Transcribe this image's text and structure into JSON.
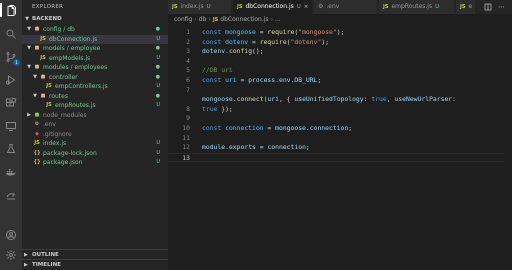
{
  "activity": {
    "items": [
      "files-icon",
      "search-icon",
      "source-control-icon",
      "run-debug-icon",
      "extensions-icon",
      "remote-icon",
      "test-icon",
      "docker-icon",
      "live-share-icon"
    ],
    "source_control_badge": "1",
    "bottom": [
      "account-icon",
      "settings-gear-icon"
    ]
  },
  "sidebar": {
    "title": "EXPLORER",
    "root": "BACKEND",
    "tree": [
      {
        "label": "config / db",
        "kind": "folder",
        "open": true,
        "depth": 1,
        "status": "●",
        "color": "green"
      },
      {
        "label": "dbConnection.js",
        "kind": "js",
        "depth": 2,
        "status": "U",
        "color": "green",
        "selected": true
      },
      {
        "label": "models / employee",
        "kind": "folder",
        "open": true,
        "depth": 1,
        "status": "●",
        "color": "green"
      },
      {
        "label": "empModels.js",
        "kind": "js",
        "depth": 2,
        "status": "U",
        "color": "green"
      },
      {
        "label": "modules / employees",
        "kind": "folder",
        "open": true,
        "depth": 1,
        "status": "●",
        "color": "green"
      },
      {
        "label": "controller",
        "kind": "folder",
        "open": true,
        "depth": 2,
        "status": "●",
        "color": "green"
      },
      {
        "label": "empControllers.js",
        "kind": "js",
        "depth": 3,
        "status": "U",
        "color": "green"
      },
      {
        "label": "routes",
        "kind": "folder",
        "open": true,
        "depth": 2,
        "status": "●",
        "color": "green"
      },
      {
        "label": "empRoutes.js",
        "kind": "js",
        "depth": 3,
        "status": "U",
        "color": "green"
      },
      {
        "label": "node_modules",
        "kind": "node",
        "open": false,
        "depth": 1,
        "status": "",
        "color": "gray"
      },
      {
        "label": ".env",
        "kind": "env",
        "depth": 1,
        "status": "",
        "color": "gray"
      },
      {
        "label": ".gitignore",
        "kind": "git",
        "depth": 1,
        "status": "",
        "color": "gray"
      },
      {
        "label": "index.js",
        "kind": "js",
        "depth": 1,
        "status": "U",
        "color": "green"
      },
      {
        "label": "package-lock.json",
        "kind": "json",
        "depth": 1,
        "status": "U",
        "color": "green"
      },
      {
        "label": "package.json",
        "kind": "json",
        "depth": 1,
        "status": "U",
        "color": "green"
      }
    ],
    "outline": "OUTLINE",
    "timeline": "TIMELINE"
  },
  "tabs": [
    {
      "icon": "JS",
      "label": "index.js",
      "status": "U",
      "active": false
    },
    {
      "icon": "JS",
      "label": "dbConnection.js",
      "status": "U",
      "active": true,
      "close": "×"
    },
    {
      "icon": "gear",
      "label": ".env",
      "status": "",
      "active": false
    },
    {
      "icon": "JS",
      "label": "empRoutes.js",
      "status": "U",
      "active": false
    },
    {
      "icon": "JS",
      "label": "e",
      "status": "",
      "active": false
    }
  ],
  "breadcrumb": {
    "parts": [
      "config",
      "db"
    ],
    "file": "dbConnection.js",
    "more": "..."
  },
  "editor": {
    "current_line": 13,
    "lines": [
      [
        [
          "kw",
          "const "
        ],
        [
          "var",
          "mongoose"
        ],
        [
          "punc",
          " = "
        ],
        [
          "fn",
          "require"
        ],
        [
          "punc",
          "("
        ],
        [
          "str",
          "\"mongoose\""
        ],
        [
          "punc",
          ");"
        ]
      ],
      [
        [
          "kw",
          "const "
        ],
        [
          "var",
          "dotenv"
        ],
        [
          "punc",
          " = "
        ],
        [
          "fn",
          "require"
        ],
        [
          "punc",
          "("
        ],
        [
          "str",
          "\"dotenv\""
        ],
        [
          "punc",
          ");"
        ]
      ],
      [
        [
          "prop",
          "dotenv"
        ],
        [
          "punc",
          "."
        ],
        [
          "fn",
          "config"
        ],
        [
          "punc",
          "();"
        ]
      ],
      [],
      [
        [
          "cmt",
          "//DB uri"
        ]
      ],
      [
        [
          "kw",
          "const "
        ],
        [
          "var",
          "uri"
        ],
        [
          "punc",
          " = "
        ],
        [
          "prop",
          "process"
        ],
        [
          "punc",
          "."
        ],
        [
          "prop",
          "env"
        ],
        [
          "punc",
          "."
        ],
        [
          "prop",
          "DB_URL"
        ],
        [
          "punc",
          ";"
        ]
      ],
      [],
      [
        [
          "prop",
          "mongoose"
        ],
        [
          "punc",
          "."
        ],
        [
          "fn",
          "connect"
        ],
        [
          "punc",
          "("
        ],
        [
          "prop",
          "uri"
        ],
        [
          "punc",
          ", { "
        ],
        [
          "prop",
          "useUnifiedTopology"
        ],
        [
          "punc",
          ": "
        ],
        [
          "kw",
          "true"
        ],
        [
          "punc",
          ", "
        ],
        [
          "prop",
          "useNewUrlParser"
        ],
        [
          "punc",
          ":"
        ]
      ],
      [
        [
          "kw",
          "true"
        ],
        [
          "punc",
          " });"
        ]
      ],
      [],
      [
        [
          "kw",
          "const "
        ],
        [
          "var",
          "connection"
        ],
        [
          "punc",
          " = "
        ],
        [
          "prop",
          "mongoose"
        ],
        [
          "punc",
          "."
        ],
        [
          "prop",
          "connection"
        ],
        [
          "punc",
          ";"
        ]
      ],
      [],
      [
        [
          "prop",
          "module"
        ],
        [
          "punc",
          "."
        ],
        [
          "prop",
          "exports"
        ],
        [
          "punc",
          " = "
        ],
        [
          "prop",
          "connection"
        ],
        [
          "punc",
          ";"
        ]
      ],
      []
    ],
    "line_numbers": [
      "1",
      "2",
      "3",
      "4",
      "5",
      "6",
      "7",
      "",
      "8",
      "9",
      "10",
      "11",
      "12",
      "13"
    ]
  },
  "colors": {
    "untracked": "#73c991",
    "js_icon": "#cbcb41",
    "keyword": "#569cd6",
    "string": "#ce9178"
  }
}
